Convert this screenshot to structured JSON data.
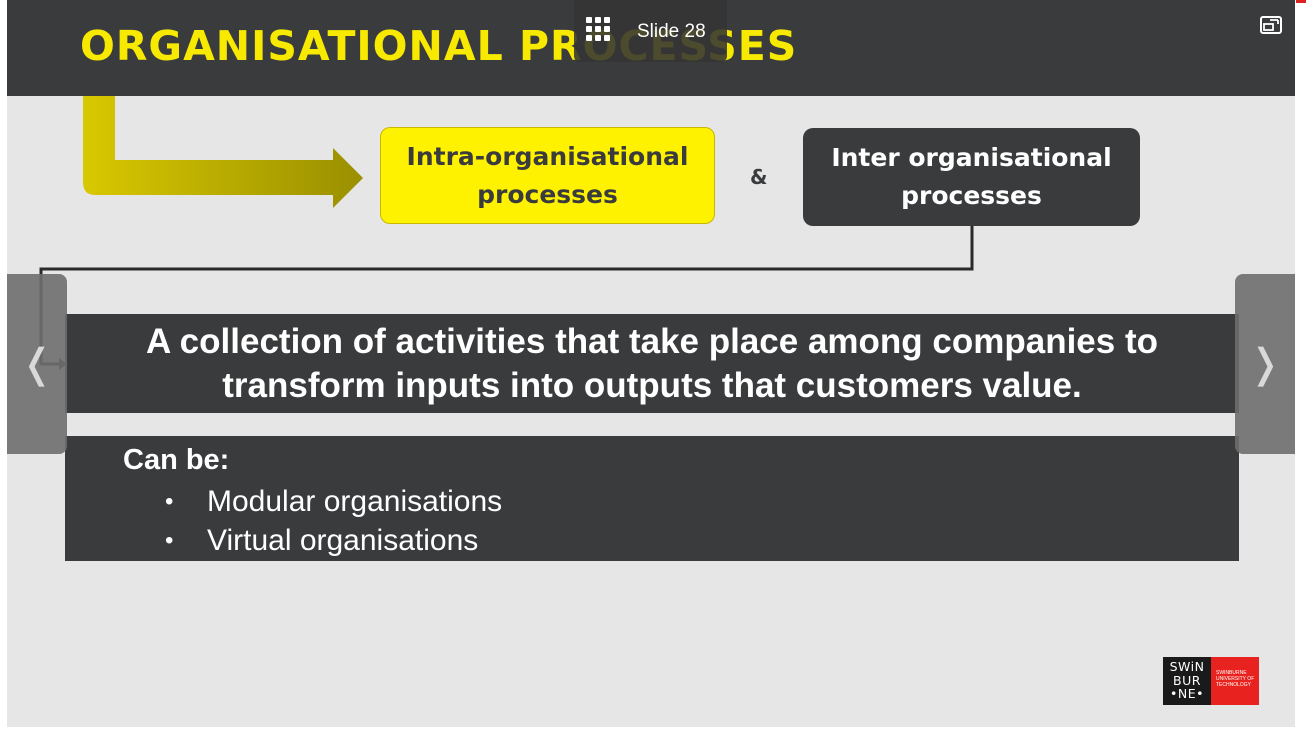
{
  "slide": {
    "title": "ORGANISATIONAL PROCESSES",
    "intra_box": "Intra-organisational processes",
    "ampersand": "&",
    "inter_box": "Inter organisational processes",
    "definition": "A collection of activities that take place among companies to transform inputs into outputs that customers value.",
    "can_be_heading": "Can be:",
    "can_be_items": [
      "Modular organisations",
      "Virtual organisations"
    ],
    "logo": {
      "wordmark_lines": [
        "SWiN",
        "BUR",
        "•NE•"
      ],
      "university_lines": [
        "SWINBURNE",
        "UNIVERSITY OF",
        "TECHNOLOGY"
      ]
    }
  },
  "viewer": {
    "slide_label": "Slide 28",
    "prev_glyph": "❬",
    "next_glyph": "❭",
    "icons": {
      "slide_grid": "grid-icon",
      "expand": "expand-icon",
      "prev": "chevron-left-icon",
      "next": "chevron-right-icon"
    }
  },
  "colors": {
    "accent_yellow": "#f7ea00",
    "dark": "#3a3b3d",
    "background": "#e6e6e6",
    "brand_red": "#e8231f"
  }
}
